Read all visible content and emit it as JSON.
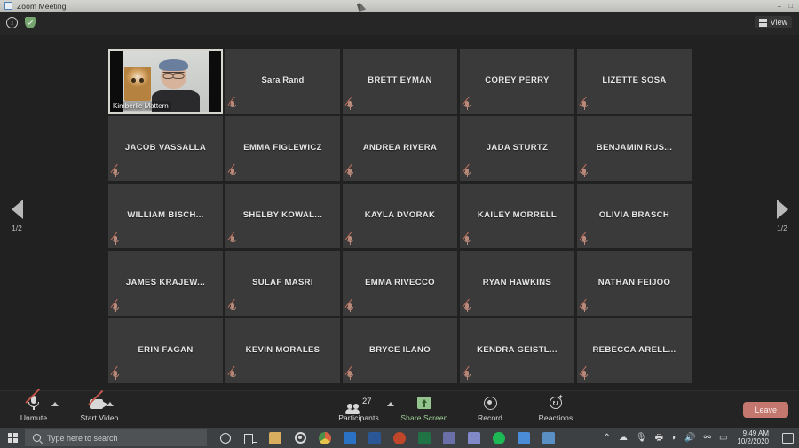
{
  "window": {
    "title": "Zoom Meeting",
    "app_icon": "zoom-app-icon",
    "minimize": "–",
    "maximize": "□",
    "close": "×"
  },
  "zoom_header": {
    "info_icon": "info-circle-icon",
    "info_glyph": "i",
    "encryption_icon": "green-shield-icon",
    "view_label": "View",
    "view_icon": "grid-view-icon"
  },
  "gallery": {
    "pager_left": {
      "icon": "chevron-left-icon",
      "label": "1/2"
    },
    "pager_right": {
      "icon": "chevron-right-icon",
      "label": "1/2"
    },
    "self_tile": {
      "name": "Kimberlie Mattern",
      "has_video": true,
      "muted": false
    },
    "participants": [
      {
        "name": "Sara Rand",
        "muted": true,
        "case": "mixed"
      },
      {
        "name": "BRETT EYMAN",
        "muted": true,
        "case": "upper"
      },
      {
        "name": "COREY PERRY",
        "muted": true,
        "case": "upper"
      },
      {
        "name": "LIZETTE SOSA",
        "muted": true,
        "case": "upper"
      },
      {
        "name": "JACOB VASSALLA",
        "muted": true,
        "case": "upper"
      },
      {
        "name": "EMMA FIGLEWICZ",
        "muted": true,
        "case": "upper"
      },
      {
        "name": "ANDREA RIVERA",
        "muted": true,
        "case": "upper"
      },
      {
        "name": "JADA STURTZ",
        "muted": true,
        "case": "upper"
      },
      {
        "name": "BENJAMIN RUS...",
        "muted": true,
        "case": "upper"
      },
      {
        "name": "WILLIAM BISCH...",
        "muted": true,
        "case": "upper"
      },
      {
        "name": "SHELBY KOWAL...",
        "muted": true,
        "case": "upper"
      },
      {
        "name": "KAYLA DVORAK",
        "muted": true,
        "case": "upper"
      },
      {
        "name": "KAILEY MORRELL",
        "muted": true,
        "case": "upper"
      },
      {
        "name": "OLIVIA BRASCH",
        "muted": true,
        "case": "upper"
      },
      {
        "name": "JAMES KRAJEW...",
        "muted": true,
        "case": "upper"
      },
      {
        "name": "SULAF MASRI",
        "muted": true,
        "case": "upper"
      },
      {
        "name": "EMMA RIVECCO",
        "muted": true,
        "case": "upper"
      },
      {
        "name": "RYAN HAWKINS",
        "muted": true,
        "case": "upper"
      },
      {
        "name": "NATHAN FEIJOO",
        "muted": true,
        "case": "upper"
      },
      {
        "name": "ERIN FAGAN",
        "muted": true,
        "case": "upper"
      },
      {
        "name": "KEVIN MORALES",
        "muted": true,
        "case": "upper"
      },
      {
        "name": "BRYCE ILANO",
        "muted": true,
        "case": "upper"
      },
      {
        "name": "KENDRA GEISTL...",
        "muted": true,
        "case": "upper"
      },
      {
        "name": "REBECCA ARELL...",
        "muted": true,
        "case": "upper"
      }
    ]
  },
  "toolbar": {
    "unmute": {
      "label": "Unmute",
      "icon": "microphone-muted-icon",
      "has_caret": true
    },
    "start_video": {
      "label": "Start Video",
      "icon": "camera-off-icon",
      "has_caret": true
    },
    "participants": {
      "label": "Participants",
      "icon": "people-icon",
      "count": "27",
      "has_caret": true
    },
    "share_screen": {
      "label": "Share Screen",
      "icon": "share-screen-icon",
      "color": "#9fd39a"
    },
    "record": {
      "label": "Record",
      "icon": "record-icon"
    },
    "reactions": {
      "label": "Reactions",
      "icon": "reactions-icon"
    },
    "leave": {
      "label": "Leave",
      "color": "#c4776f"
    }
  },
  "taskbar": {
    "start_icon": "windows-start-icon",
    "search_placeholder": "Type here to search",
    "search_icon": "search-icon",
    "apps": [
      {
        "name": "cortana-icon",
        "type": "cortana"
      },
      {
        "name": "task-view-icon",
        "type": "taskview"
      },
      {
        "name": "file-explorer-icon",
        "color": "#e8c069"
      },
      {
        "name": "settings-gear-icon",
        "type": "gear"
      },
      {
        "name": "google-chrome-icon",
        "color": "#d8623f"
      },
      {
        "name": "outlook-icon",
        "color": "#1f6ebd"
      },
      {
        "name": "word-icon",
        "color": "#2b5797"
      },
      {
        "name": "powerpoint-icon",
        "color": "#c0462a"
      },
      {
        "name": "excel-icon",
        "color": "#217346"
      },
      {
        "name": "onenote-icon",
        "color": "#6b5fa8"
      },
      {
        "name": "teams-icon",
        "color": "#7b83c4"
      },
      {
        "name": "spotify-icon",
        "color": "#1db954"
      },
      {
        "name": "zoom-taskbar-icon",
        "color": "#4a8cd8"
      },
      {
        "name": "photos-icon",
        "color": "#5a8fc4"
      }
    ],
    "tray": {
      "chevron_icon": "chevron-up-icon",
      "cloud_icon": "onedrive-icon",
      "mic_icon": "microphone-tray-icon",
      "printer_icon": "printer-icon",
      "wifi_icon": "wifi-icon",
      "volume_icon": "volume-icon",
      "network_icon": "network-share-icon",
      "battery_icon": "battery-icon",
      "time": "9:49 AM",
      "date": "10/2/2020",
      "notifications_icon": "action-center-icon"
    }
  }
}
